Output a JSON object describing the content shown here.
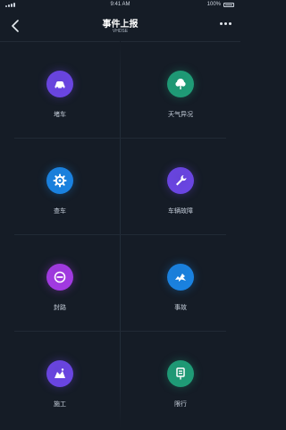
{
  "status_bar": {
    "time": "9:41 AM",
    "battery": "100%"
  },
  "nav": {
    "title": "事件上报",
    "subtitle": "VHDSE"
  },
  "tiles": [
    {
      "label": "堵车",
      "icon": "car-icon",
      "color": "#6c46e6"
    },
    {
      "label": "天气异况",
      "icon": "tree-weather-icon",
      "color": "#1f9e78"
    },
    {
      "label": "查车",
      "icon": "gear-icon",
      "color": "#1a84e4"
    },
    {
      "label": "车辆故障",
      "icon": "wrench-icon",
      "color": "#6c46e6"
    },
    {
      "label": "封路",
      "icon": "no-entry-icon",
      "color": "#a53be6"
    },
    {
      "label": "事故",
      "icon": "crash-icon",
      "color": "#1a84e4"
    },
    {
      "label": "施工",
      "icon": "construction-icon",
      "color": "#6c46e6"
    },
    {
      "label": "限行",
      "icon": "restriction-sign-icon",
      "color": "#1f9e78"
    }
  ]
}
